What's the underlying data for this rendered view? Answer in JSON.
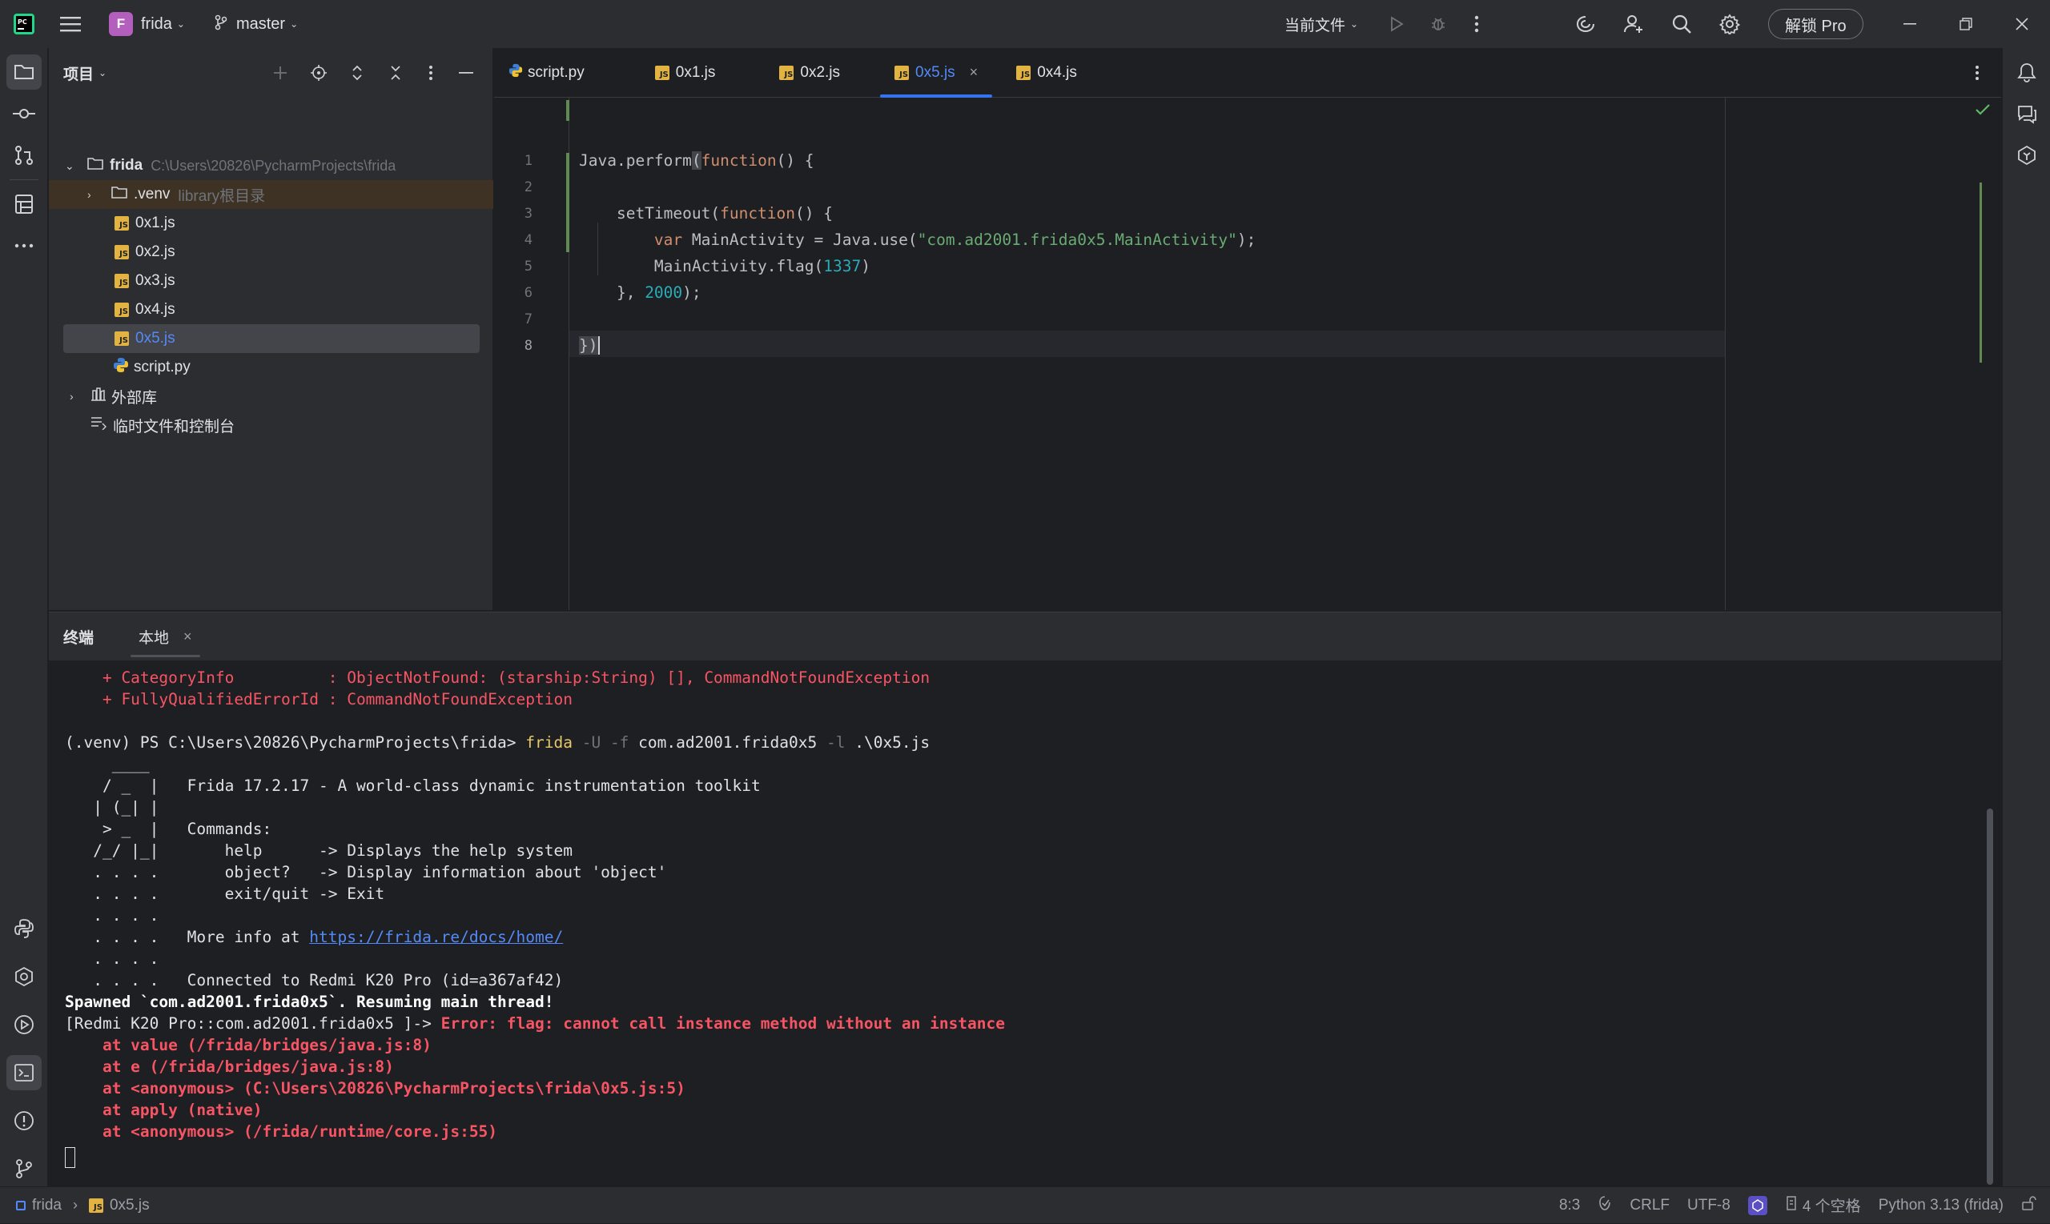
{
  "titlebar": {
    "project_initial": "F",
    "project_name": "frida",
    "branch": "master",
    "run_config": "当前文件",
    "unlock_button": "解锁 Pro"
  },
  "project_panel": {
    "title": "项目",
    "root": {
      "name": "frida",
      "path": "C:\\Users\\20826\\PycharmProjects\\frida"
    },
    "venv": {
      "name": ".venv",
      "tag": "library根目录"
    },
    "files": [
      "0x1.js",
      "0x2.js",
      "0x3.js",
      "0x4.js",
      "0x5.js",
      "script.py"
    ],
    "external_libs": "外部库",
    "scratches": "临时文件和控制台"
  },
  "editor": {
    "tabs": [
      {
        "label": "script.py",
        "type": "py"
      },
      {
        "label": "0x1.js",
        "type": "js"
      },
      {
        "label": "0x2.js",
        "type": "js"
      },
      {
        "label": "0x5.js",
        "type": "js",
        "active": true
      },
      {
        "label": "0x4.js",
        "type": "js"
      }
    ],
    "line_numbers": [
      "1",
      "2",
      "3",
      "4",
      "5",
      "6",
      "7",
      "8"
    ],
    "code": {
      "l1_a": "Java.perform",
      "l1_b": "(",
      "l1_c": "function",
      "l1_d": "() {",
      "l3_a": "    setTimeout(",
      "l3_b": "function",
      "l3_c": "() {",
      "l4_a": "        ",
      "l4_b": "var",
      "l4_c": " MainActivity = Java.use(",
      "l4_d": "\"com.ad2001.frida0x5.MainActivity\"",
      "l4_e": ");",
      "l5_a": "        MainActivity.flag(",
      "l5_b": "1337",
      "l5_c": ")",
      "l6_a": "    }, ",
      "l6_b": "2000",
      "l6_c": ");",
      "l8_a": "}",
      "l8_b": ")"
    }
  },
  "terminal": {
    "title": "终端",
    "tab": "本地",
    "lines": {
      "err1": "    + CategoryInfo          : ObjectNotFound: (starship:String) [], CommandNotFoundException",
      "err2": "    + FullyQualifiedErrorId : CommandNotFoundException",
      "prompt": "(.venv) PS C:\\Users\\20826\\PycharmProjects\\frida> ",
      "cmd": "frida",
      "flag_u": " -U",
      "flag_f": " -f",
      "pkg": " com.ad2001.frida0x5",
      "flag_l": " -l",
      "script": " .\\0x5.js",
      "b1": "     ____",
      "b2": "    / _  |   Frida 17.2.17 - A world-class dynamic instrumentation toolkit",
      "b3": "   | (_| |",
      "b4": "    > _  |   Commands:",
      "b5": "   /_/ |_|       help      -> Displays the help system",
      "b6": "   . . . .       object?   -> Display information about 'object'",
      "b7": "   . . . .       exit/quit -> Exit",
      "b8": "   . . . .",
      "b9a": "   . . . .   More info at ",
      "b9b": "https://frida.re/docs/home/",
      "b10": "   . . . .",
      "b11": "   . . . .   Connected to Redmi K20 Pro (id=a367af42)",
      "spawned": "Spawned `com.ad2001.frida0x5`. Resuming main thread!",
      "repl": "[Redmi K20 Pro::com.ad2001.frida0x5 ]-> ",
      "error": "Error: flag: cannot call instance method without an instance",
      "st1": "    at value (/frida/bridges/java.js:8)",
      "st2": "    at e (/frida/bridges/java.js:8)",
      "st3": "    at <anonymous> (C:\\Users\\20826\\PycharmProjects\\frida\\0x5.js:5)",
      "st4": "    at apply (native)",
      "st5": "    at <anonymous> (/frida/runtime/core.js:55)"
    }
  },
  "statusbar": {
    "crumb_project": "frida",
    "crumb_file": "0x5.js",
    "position": "8:3",
    "line_sep": "CRLF",
    "encoding": "UTF-8",
    "indent": "4 个空格",
    "interpreter": "Python 3.13 (frida)"
  },
  "colors": {
    "accent": "#3574f0",
    "keyword": "#cf8e6d",
    "string": "#6aab73",
    "number": "#2aacb8",
    "error": "#f75464"
  }
}
